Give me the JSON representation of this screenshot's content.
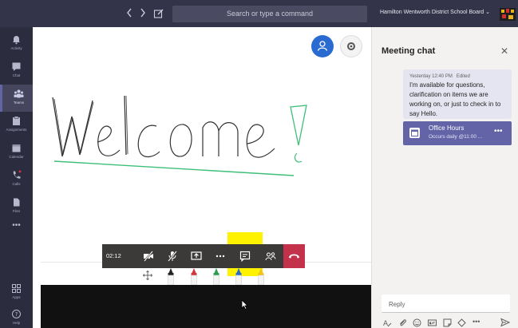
{
  "topbar": {
    "back_icon": "chevron-left-icon",
    "forward_icon": "chevron-right-icon",
    "compose_icon": "compose-icon",
    "search_placeholder": "Search or type a command",
    "org_name": "Hamilton Wentworth District School Board",
    "org_chevron": "⌄"
  },
  "rail": {
    "items": [
      {
        "label": "Activity",
        "icon": "bell-icon"
      },
      {
        "label": "Chat",
        "icon": "chat-icon"
      },
      {
        "label": "Teams",
        "icon": "teams-icon",
        "active": true
      },
      {
        "label": "Assignments",
        "icon": "assignments-icon"
      },
      {
        "label": "Calendar",
        "icon": "calendar-icon"
      },
      {
        "label": "Calls",
        "icon": "phone-icon"
      },
      {
        "label": "Files",
        "icon": "files-icon"
      }
    ],
    "more": "•••",
    "bottom": [
      {
        "label": "Apps",
        "icon": "apps-icon"
      },
      {
        "label": "Help",
        "icon": "help-icon"
      }
    ]
  },
  "callbar": {
    "timer": "02:12",
    "buttons": [
      "camera-off-icon",
      "mic-off-icon",
      "share-screen-icon",
      "more-icon",
      "chat-icon",
      "participants-icon",
      "hang-up-icon"
    ],
    "more_label": "•••"
  },
  "pens": {
    "colors": [
      "#222222",
      "#d1343a",
      "#2e9e55",
      "#2a6bd1",
      "#f0c419"
    ]
  },
  "chat": {
    "title": "Meeting chat",
    "close": "✕",
    "message": {
      "time": "Yesterday 12:40 PM",
      "edited": "Edited",
      "text": "I'm available for questions, clarification on items we are working on, or just to check in to say Hello."
    },
    "card": {
      "title": "Office Hours",
      "subtitle": "Occurs daily @11:00 ...",
      "more": "•••"
    },
    "reply_placeholder": "Reply",
    "tools": [
      "format-icon",
      "attach-icon",
      "emoji-icon",
      "gif-icon",
      "sticker-icon",
      "meet-icon",
      "more-icon"
    ],
    "tools_more": "•••"
  },
  "colors": {
    "accent": "#6264a7",
    "topbar": "#33344a",
    "rail": "#2b2c3e",
    "hangup": "#c4314b"
  }
}
